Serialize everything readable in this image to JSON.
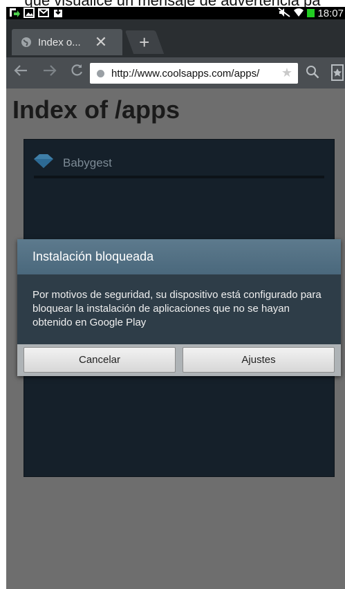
{
  "caption": "que visualice un mensaje de advertencia pa",
  "status_bar": {
    "time": "18:07",
    "left_icons": [
      "notification-arrow-icon",
      "image-icon",
      "gmail-icon",
      "download-icon"
    ],
    "right_icons": [
      "mute-icon",
      "wifi-icon",
      "battery-icon"
    ]
  },
  "browser": {
    "tab": {
      "title": "Index o...",
      "close_label": "✕"
    },
    "new_tab_label": "+",
    "url": "http://www.coolsapps.com/apps/"
  },
  "page": {
    "title": "Index of /apps",
    "items": [
      {
        "label": "Babygest"
      }
    ]
  },
  "dialog": {
    "title": "Instalación bloqueada",
    "message": "Por motivos de seguridad, su dispositivo está configurado para bloquear la instalación de aplicaciones que no se hayan obtenido en Google Play",
    "buttons": {
      "cancel": "Cancelar",
      "settings": "Ajustes"
    }
  },
  "colors": {
    "dialog_title_bg": "#556f82",
    "dialog_body_bg": "#2e3d48",
    "page_bg": "#6e6e6e",
    "battery": "#22cc22"
  }
}
